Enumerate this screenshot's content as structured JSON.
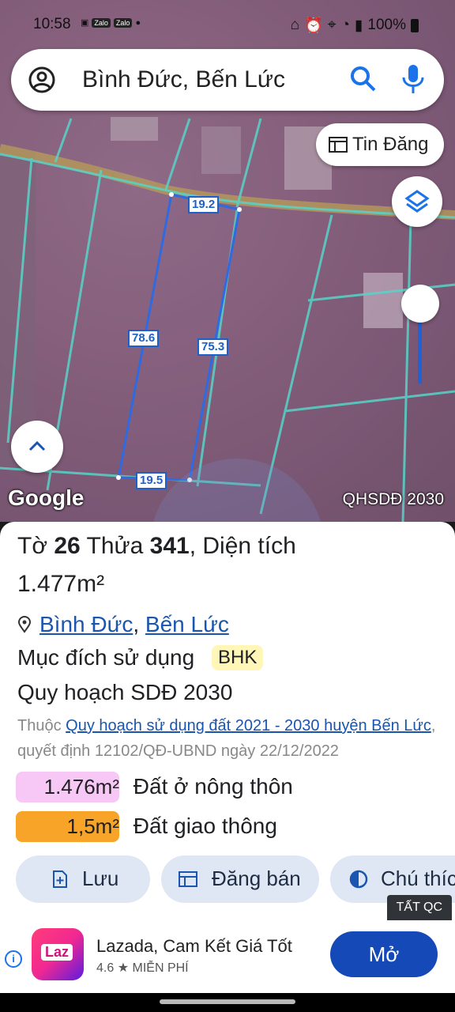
{
  "status_bar": {
    "time": "10:58",
    "battery": "100%"
  },
  "search": {
    "query": "Bình Đức, Bến Lức"
  },
  "map": {
    "tin_dang_label": "Tin Đăng",
    "google_label": "Google",
    "overlay_label": "QHSDĐ 2030",
    "measurements": {
      "top": "19.2",
      "left": "78.6",
      "right": "75.3",
      "bottom": "19.5"
    }
  },
  "parcel": {
    "to_label": "Tờ",
    "to_number": "26",
    "thua_label": "Thửa",
    "thua_number": "341",
    "area_label": ", Diện tích",
    "area_value": "1.477m²",
    "commune": "Bình Đức",
    "separator": ",",
    "district": "Bến Lức",
    "purpose_label": "Mục đích sử dụng",
    "purpose_code": "BHK",
    "plan_title": "Quy hoạch SDĐ 2030",
    "desc_prefix": "Thuộc",
    "desc_link": "Quy hoạch sử dụng đất 2021 - 2030 huyện Bến Lức",
    "desc_suffix": ", quyết định 12102/QĐ-UBND ngày 22/12/2022",
    "land_uses": [
      {
        "area": "1.476m²",
        "label": "Đất ở nông thôn",
        "color": "#f7c8f5"
      },
      {
        "area": "1,5m²",
        "label": "Đất giao thông",
        "color": "#f7a428"
      }
    ]
  },
  "actions": {
    "save": "Lưu",
    "post_sale": "Đăng bán",
    "note": "Chú thích"
  },
  "ad": {
    "badge": "TẤT QC",
    "logo_text": "Laz",
    "title": "Lazada, Cam Kết Giá Tốt",
    "rating": "4.6",
    "price": "MIỄN PHÍ",
    "cta": "Mở"
  }
}
